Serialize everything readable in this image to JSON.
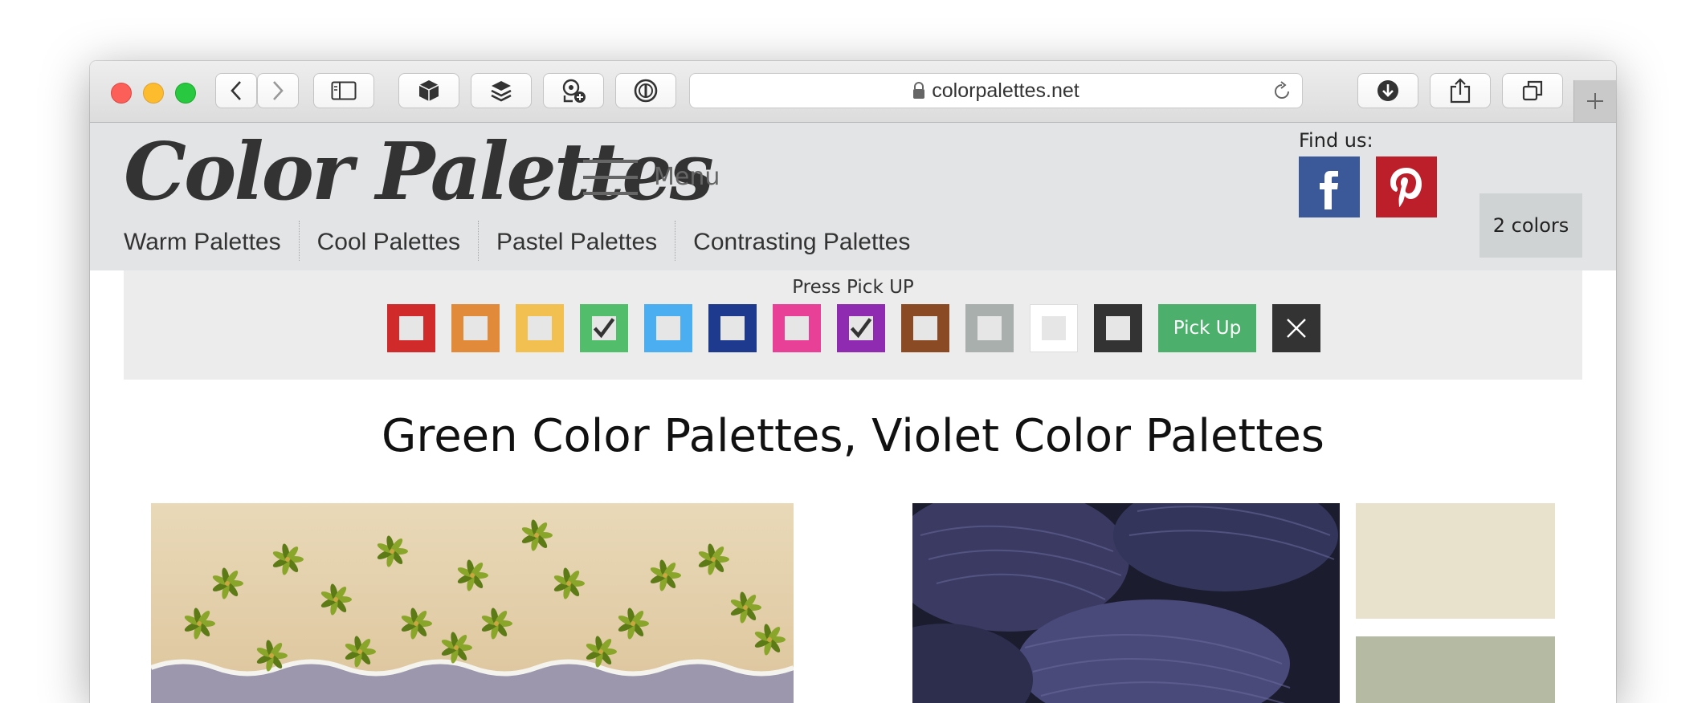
{
  "browser": {
    "url": "colorpalettes.net"
  },
  "site": {
    "logo": "Color Palettes",
    "menu_label": "Menu",
    "find_us": "Find us:",
    "colors_count": "2 colors",
    "nav": [
      "Warm Palettes",
      "Cool Palettes",
      "Pastel Palettes",
      "Contrasting Palettes"
    ]
  },
  "picker": {
    "title": "Press Pick UP",
    "pickup_label": "Pick Up",
    "swatches": [
      {
        "name": "red",
        "color": "#d12a2a",
        "checked": false
      },
      {
        "name": "orange",
        "color": "#e08a3a",
        "checked": false
      },
      {
        "name": "yellow",
        "color": "#f2c050",
        "checked": false
      },
      {
        "name": "green",
        "color": "#52be6c",
        "checked": true
      },
      {
        "name": "light-blue",
        "color": "#4aaef0",
        "checked": false
      },
      {
        "name": "dark-blue",
        "color": "#1e3a8e",
        "checked": false
      },
      {
        "name": "pink",
        "color": "#e84096",
        "checked": false
      },
      {
        "name": "violet",
        "color": "#8e2bb0",
        "checked": true
      },
      {
        "name": "brown",
        "color": "#8a4a24",
        "checked": false
      },
      {
        "name": "gray",
        "color": "#a9afad",
        "checked": false
      },
      {
        "name": "white",
        "color": "#ffffff",
        "checked": false
      },
      {
        "name": "black",
        "color": "#333333",
        "checked": false
      }
    ]
  },
  "heading": "Green Color Palettes, Violet Color Palettes",
  "palette_colors": [
    "#e8e1cb",
    "#b5bba2"
  ]
}
